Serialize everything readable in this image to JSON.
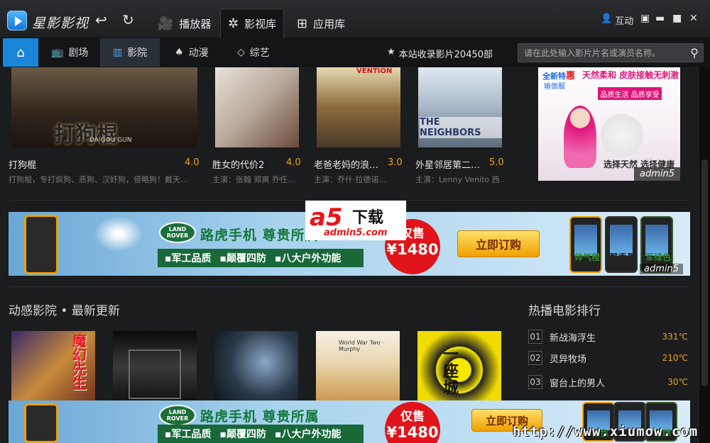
{
  "app": {
    "title": "星影影视"
  },
  "nav": [
    {
      "label": "播放器",
      "icon": "camera-icon"
    },
    {
      "label": "影视库",
      "icon": "film-reel-icon",
      "active": true
    },
    {
      "label": "应用库",
      "icon": "add-app-icon"
    }
  ],
  "window": {
    "interact_label": "互动"
  },
  "categories": [
    {
      "label": "剧场",
      "icon": "tv-icon"
    },
    {
      "label": "影院",
      "icon": "cinema-icon",
      "active": true
    },
    {
      "label": "动漫",
      "icon": "animation-icon"
    },
    {
      "label": "综艺",
      "icon": "diamond-icon"
    }
  ],
  "stats": {
    "text": "本站收录影片20450部"
  },
  "search": {
    "placeholder": "请在此处输入影片片名或演员名称。"
  },
  "movies": [
    {
      "title": "打狗棍",
      "score": "4.0",
      "cast": "打狗棍，专打疯狗、恶狗、汉奸狗，侵略狗！戴天…",
      "poster_text": "打狗棍",
      "poster_sub": "DA GOU GUN"
    },
    {
      "title": "胜女的代价2",
      "score": "4.0",
      "cast": "主演：张翰 郑爽 乔任…"
    },
    {
      "title": "老爸老妈的浪…",
      "score": "3.0",
      "cast": "主演：乔什·拉德诺…",
      "poster_text": "VENTION"
    },
    {
      "title": "外星邻居第二…",
      "score": "5.0",
      "cast": "主演：Lenny Venito 西…",
      "poster_text": "THE NEIGHBORS"
    }
  ],
  "side_ad": {
    "brand_prefix": "全新特",
    "brand_mark": "惠",
    "product": "瑜伽服",
    "slogan": "天然柔和 皮肤接触无刺激",
    "tagline": "品质生活 品质享受",
    "bottom_text": "选择天然 选择健康",
    "tag": "admin5"
  },
  "banner_ad": {
    "brand": "LAND ROVER",
    "headline": "路虎手机  尊贵所属",
    "features": [
      "▪军工品质",
      "▪颠覆四防",
      "▪八大户外功能"
    ],
    "price_label": "仅售",
    "price_value": "¥1480",
    "buy_label": "立即订购",
    "phones_top": [
      "帅气橙",
      "酷香黑",
      "军绿色"
    ],
    "phones_bottom": [
      "橙色",
      "香黑",
      "军绿"
    ],
    "tag": "admin5"
  },
  "watermark": {
    "a5_logo": "a5",
    "a5_text": "下载",
    "a5_url": "admin5.com",
    "site": "http://www.xiumow.com"
  },
  "section_latest": {
    "title": "动感影院 • 最新更新"
  },
  "latest_posters": [
    {
      "text": "魔幻先生"
    },
    {
      "text": ""
    },
    {
      "text": ""
    },
    {
      "text": "World War Two · Murphy"
    },
    {
      "text": "一座城"
    }
  ],
  "section_hot": {
    "title": "热播电影排行"
  },
  "ranking": [
    {
      "rank": "01",
      "name": "新战海浮生",
      "heat": "331℃"
    },
    {
      "rank": "02",
      "name": "灵异牧场",
      "heat": "210℃"
    },
    {
      "rank": "03",
      "name": "窗台上的男人",
      "heat": "30℃"
    }
  ]
}
